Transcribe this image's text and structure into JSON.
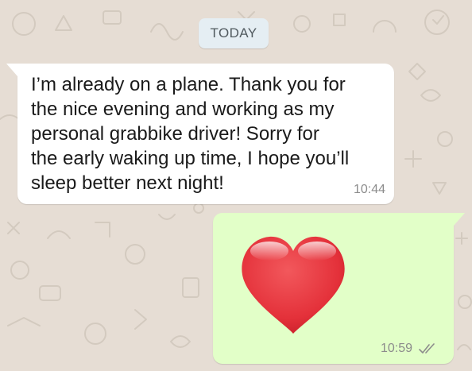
{
  "chat": {
    "date_separator": "TODAY",
    "messages": [
      {
        "direction": "incoming",
        "text": "I’m already on a plane. Thank you for\nthe nice evening and working as my\npersonal grabbike driver! Sorry for\nthe early waking up time, I hope you’ll\nsleep better next night!",
        "time": "10:44"
      },
      {
        "direction": "outgoing",
        "content": "red-heart-emoji",
        "time": "10:59",
        "status": "double-check-icon"
      }
    ]
  },
  "colors": {
    "wallpaper": "#e6ddd4",
    "incoming_bubble": "#ffffff",
    "outgoing_bubble": "#e2ffc8",
    "heart": "#e8333b",
    "timestamp": "#8c8c8c"
  }
}
